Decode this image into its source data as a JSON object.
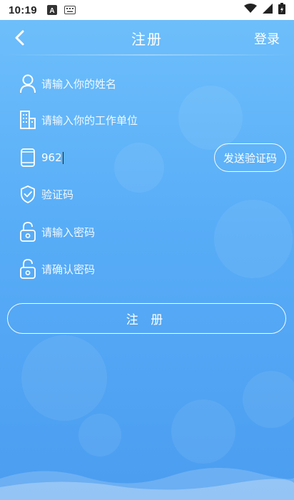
{
  "status_bar": {
    "time": "10:19",
    "icons": [
      "a-box-icon",
      "keyboard-icon",
      "wifi-icon",
      "signal-icon",
      "battery-icon"
    ]
  },
  "header": {
    "title": "注册",
    "login_label": "登录",
    "back_icon": "chevron-left-icon"
  },
  "form": {
    "name": {
      "placeholder": "请输入你的姓名",
      "value": "",
      "icon": "user-icon"
    },
    "company": {
      "placeholder": "请输入你的工作单位",
      "value": "",
      "icon": "building-icon"
    },
    "phone": {
      "placeholder": "",
      "value": "962",
      "icon": "phone-icon"
    },
    "send_code_label": "发送验证码",
    "code": {
      "placeholder": "验证码",
      "value": "",
      "icon": "shield-check-icon"
    },
    "password": {
      "placeholder": "请输入密码",
      "value": "",
      "icon": "lock-icon"
    },
    "confirm_password": {
      "placeholder": "请确认密码",
      "value": "",
      "icon": "lock-icon"
    },
    "submit_label": "注 册"
  },
  "colors": {
    "background_top": "#6fc0fb",
    "background_bottom": "#4b9df0",
    "status_bar": "#ffffff",
    "text": "#ffffff"
  }
}
